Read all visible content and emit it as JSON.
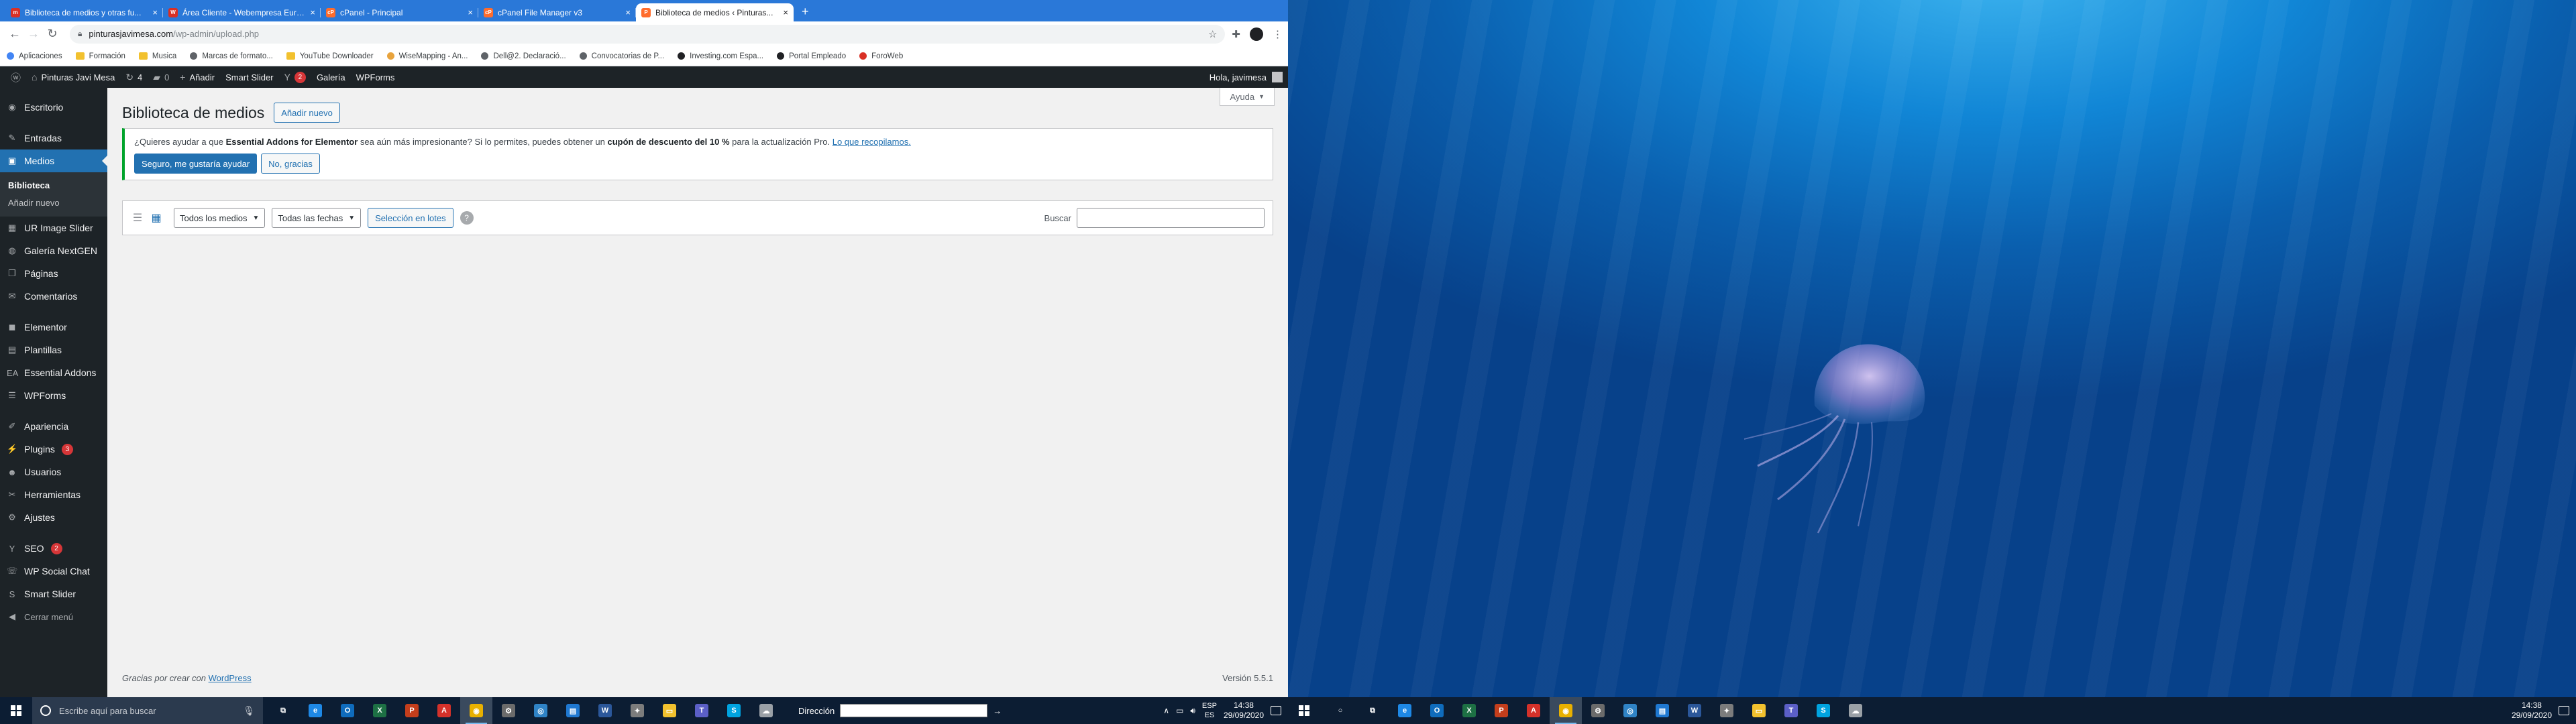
{
  "browser": {
    "tabs": [
      {
        "title": "Biblioteca de medios y otras fu...",
        "fav_color": "#d93025",
        "fav_letter": "m",
        "active": false
      },
      {
        "title": "Área Cliente - Webempresa Euro...",
        "fav_color": "#d93025",
        "fav_letter": "W",
        "active": false
      },
      {
        "title": "cPanel - Principal",
        "fav_color": "#ff6c2c",
        "fav_letter": "cP",
        "active": false
      },
      {
        "title": "cPanel File Manager v3",
        "fav_color": "#ff6c2c",
        "fav_letter": "cP",
        "active": false
      },
      {
        "title": "Biblioteca de medios ‹ Pinturas...",
        "fav_color": "#ff6c2c",
        "fav_letter": "P",
        "active": true
      }
    ],
    "url_host": "pinturasjavimesa.com",
    "url_path": "/wp-admin/upload.php",
    "bookmarks": [
      {
        "label": "Aplicaciones",
        "icon": "apps-grid-icon",
        "color": "#4285f4"
      },
      {
        "label": "Formación",
        "icon": "folder-icon",
        "color": "#f2c12e"
      },
      {
        "label": "Musica",
        "icon": "folder-icon",
        "color": "#f2c12e"
      },
      {
        "label": "Marcas de formato...",
        "icon": "page-icon",
        "color": "#5f6368"
      },
      {
        "label": "YouTube Downloader",
        "icon": "folder-icon",
        "color": "#f2c12e"
      },
      {
        "label": "WiseMapping - An...",
        "icon": "mindmap-icon",
        "color": "#e8a33d"
      },
      {
        "label": "Dell@2. Declaració...",
        "icon": "cloud-icon",
        "color": "#5f6368"
      },
      {
        "label": "Convocatorias de P...",
        "icon": "globe-icon",
        "color": "#5f6368"
      },
      {
        "label": "Investing.com Espa...",
        "icon": "investing-icon",
        "color": "#202124"
      },
      {
        "label": "Portal Empleado",
        "icon": "portal-icon",
        "color": "#202124"
      },
      {
        "label": "ForoWeb",
        "icon": "foroweb-icon",
        "color": "#d93025"
      }
    ]
  },
  "adminbar": {
    "site_name": "Pinturas Javi Mesa",
    "updates_count": "4",
    "comments_count": "0",
    "new_label": "Añadir",
    "smart_slider": "Smart Slider",
    "yoast_badge": "2",
    "gallery": "Galería",
    "wpforms": "WPForms",
    "greeting": "Hola, javimesa"
  },
  "sidebar": {
    "items": [
      {
        "label": "Escritorio",
        "icon": "dashboard-icon",
        "glyph": "◉"
      },
      {
        "sep": true
      },
      {
        "label": "Entradas",
        "icon": "pin-icon",
        "glyph": "✎"
      },
      {
        "label": "Medios",
        "icon": "media-icon",
        "glyph": "▣",
        "current": true
      },
      {
        "submenu": [
          {
            "label": "Biblioteca",
            "current": true
          },
          {
            "label": "Añadir nuevo"
          }
        ]
      },
      {
        "label": "UR Image Slider",
        "icon": "slider-icon",
        "glyph": "▦"
      },
      {
        "label": "Galería NextGEN",
        "icon": "gallery-icon",
        "glyph": "◍"
      },
      {
        "label": "Páginas",
        "icon": "pages-icon",
        "glyph": "❐"
      },
      {
        "label": "Comentarios",
        "icon": "comments-icon",
        "glyph": "✉"
      },
      {
        "sep": true
      },
      {
        "label": "Elementor",
        "icon": "elementor-icon",
        "glyph": "◼"
      },
      {
        "label": "Plantillas",
        "icon": "templates-icon",
        "glyph": "▤"
      },
      {
        "label": "Essential Addons",
        "icon": "ea-icon",
        "glyph": "EA"
      },
      {
        "label": "WPForms",
        "icon": "forms-icon",
        "glyph": "☰"
      },
      {
        "sep": true
      },
      {
        "label": "Apariencia",
        "icon": "brush-icon",
        "glyph": "✐"
      },
      {
        "label": "Plugins",
        "icon": "plugins-icon",
        "glyph": "⚡",
        "badge": "3"
      },
      {
        "label": "Usuarios",
        "icon": "users-icon",
        "glyph": "☻"
      },
      {
        "label": "Herramientas",
        "icon": "tools-icon",
        "glyph": "✂"
      },
      {
        "label": "Ajustes",
        "icon": "settings-icon",
        "glyph": "⚙"
      },
      {
        "sep": true
      },
      {
        "label": "SEO",
        "icon": "yoast-icon",
        "glyph": "Y",
        "badge": "2"
      },
      {
        "label": "WP Social Chat",
        "icon": "chat-icon",
        "glyph": "☏"
      },
      {
        "label": "Smart Slider",
        "icon": "smartslider-icon",
        "glyph": "S"
      },
      {
        "label": "Cerrar menú",
        "icon": "collapse-icon",
        "glyph": "◀",
        "collapse": true
      }
    ]
  },
  "page": {
    "help": "Ayuda",
    "title": "Biblioteca de medios",
    "add_new": "Añadir nuevo",
    "notice": {
      "prefix": "¿Quieres ayudar a que ",
      "plugin": "Essential Addons for Elementor",
      "middle": " sea aún más impresionante? Si lo permites, puedes obtener un ",
      "discount": "cupón de descuento del 10 %",
      "suffix": " para la actualización Pro. ",
      "link": "Lo que recopilamos.",
      "accept": "Seguro, me gustaría ayudar",
      "decline": "No, gracias"
    },
    "filters": {
      "media_type": "Todos los medios",
      "dates": "Todas las fechas",
      "bulk": "Selección en lotes",
      "search_label": "Buscar"
    },
    "footer": {
      "thanks_prefix": "Gracias por crear con ",
      "thanks_link": "WordPress",
      "version": "Versión 5.5.1"
    }
  },
  "taskbar": {
    "search_placeholder": "Escribe aquí para buscar",
    "address_label": "Dirección",
    "lang_top": "ESP",
    "lang_bottom": "ES",
    "time": "14:38",
    "date": "29/09/2020",
    "apps": [
      {
        "icon": "task-view-icon",
        "color": "transparent",
        "letter": "⧉"
      },
      {
        "icon": "edge-icon",
        "color": "#1e88e5",
        "letter": "e"
      },
      {
        "icon": "outlook-icon",
        "color": "#0f6cbd",
        "letter": "O"
      },
      {
        "icon": "excel-icon",
        "color": "#1d7044",
        "letter": "X"
      },
      {
        "icon": "powerpoint-icon",
        "color": "#c43e1c",
        "letter": "P"
      },
      {
        "icon": "acrobat-icon",
        "color": "#d4312a",
        "letter": "A"
      },
      {
        "icon": "chrome-icon",
        "color": "#e8b000",
        "letter": "◉",
        "open": true,
        "active": true
      },
      {
        "icon": "settings-icon",
        "color": "#6b6b6b",
        "letter": "⚙"
      },
      {
        "icon": "maps-icon",
        "color": "#2f83c6",
        "letter": "◎"
      },
      {
        "icon": "store-icon",
        "color": "#1f78d1",
        "letter": "▤"
      },
      {
        "icon": "word-icon",
        "color": "#2b579a",
        "letter": "W"
      },
      {
        "icon": "tool-icon",
        "color": "#7c7c7c",
        "letter": "✦"
      },
      {
        "icon": "explorer-icon",
        "color": "#f2c12e",
        "letter": "▭"
      },
      {
        "icon": "teams-icon",
        "color": "#5b5fc7",
        "letter": "T"
      },
      {
        "icon": "skype-icon",
        "color": "#00a3e0",
        "letter": "S"
      },
      {
        "icon": "cloud-icon",
        "color": "#9aa0a6",
        "letter": "☁"
      }
    ],
    "right_apps": [
      {
        "icon": "task-view-icon",
        "color": "transparent",
        "letter": "○"
      },
      {
        "icon": "task-view-icon",
        "color": "transparent",
        "letter": "⧉"
      },
      {
        "icon": "edge-icon",
        "color": "#1e88e5",
        "letter": "e"
      },
      {
        "icon": "outlook-icon",
        "color": "#0f6cbd",
        "letter": "O"
      },
      {
        "icon": "excel-icon",
        "color": "#1d7044",
        "letter": "X"
      },
      {
        "icon": "powerpoint-icon",
        "color": "#c43e1c",
        "letter": "P"
      },
      {
        "icon": "acrobat-icon",
        "color": "#d4312a",
        "letter": "A"
      },
      {
        "icon": "chrome-icon",
        "color": "#e8b000",
        "letter": "◉",
        "open": true,
        "active": true
      },
      {
        "icon": "settings-icon",
        "color": "#6b6b6b",
        "letter": "⚙"
      },
      {
        "icon": "maps-icon",
        "color": "#2f83c6",
        "letter": "◎"
      },
      {
        "icon": "store-icon",
        "color": "#1f78d1",
        "letter": "▤"
      },
      {
        "icon": "word-icon",
        "color": "#2b579a",
        "letter": "W"
      },
      {
        "icon": "tool-icon",
        "color": "#7c7c7c",
        "letter": "✦"
      },
      {
        "icon": "explorer-icon",
        "color": "#f2c12e",
        "letter": "▭"
      },
      {
        "icon": "teams-icon",
        "color": "#5b5fc7",
        "letter": "T"
      },
      {
        "icon": "skype-icon",
        "color": "#00a3e0",
        "letter": "S"
      },
      {
        "icon": "cloud-icon",
        "color": "#9aa0a6",
        "letter": "☁"
      }
    ]
  },
  "colors": {
    "wp_dark": "#1d2327",
    "wp_accent": "#2271b1",
    "chrome_tabbar": "#2a78d8",
    "desktop_blue": "#1186d6"
  }
}
